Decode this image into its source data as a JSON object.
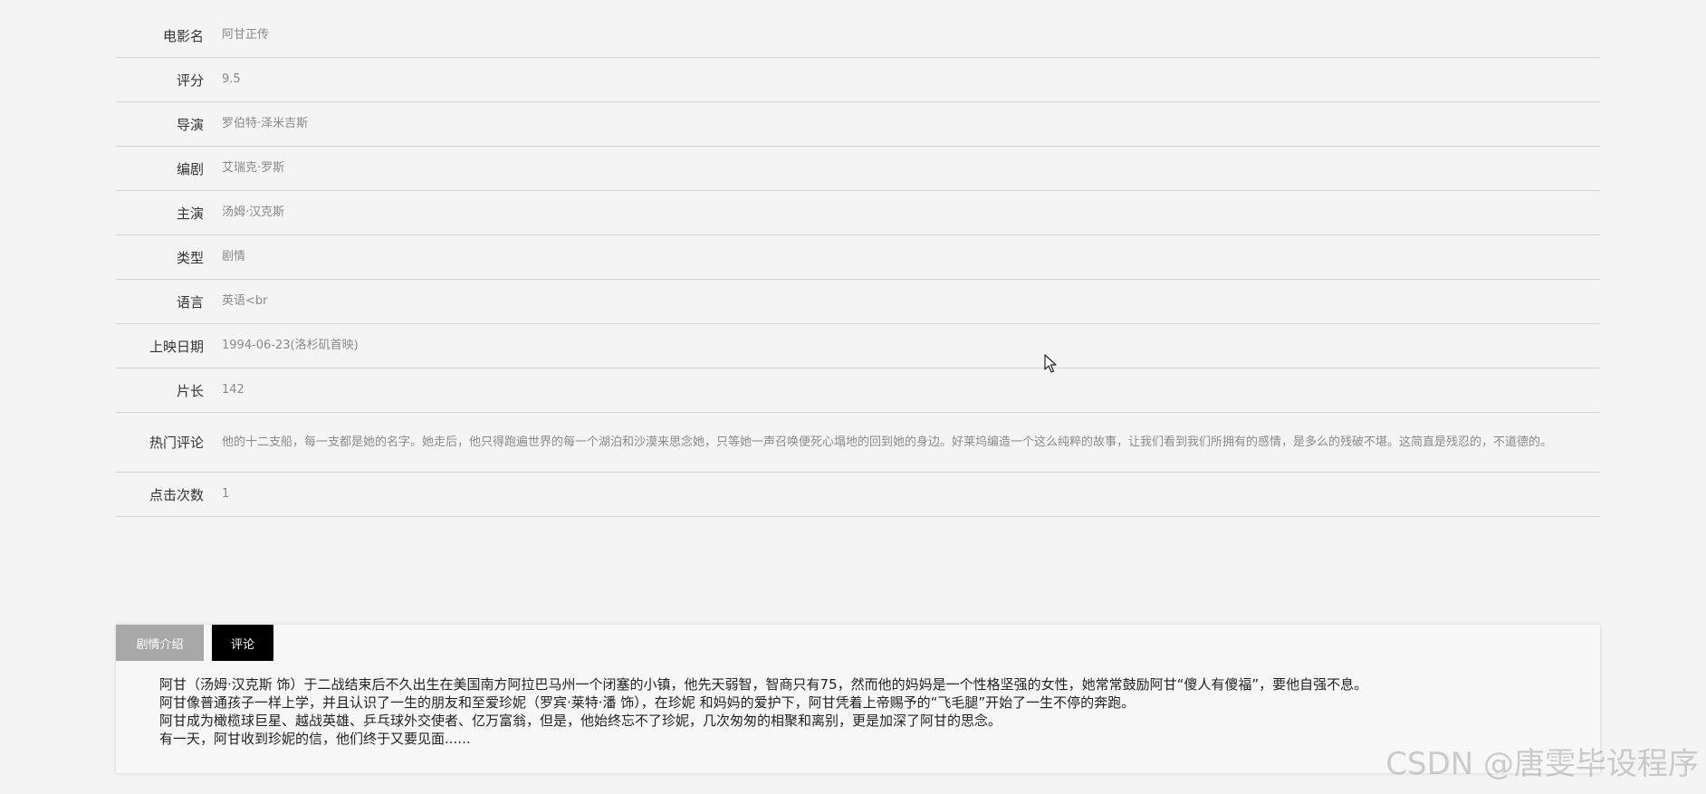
{
  "movie": {
    "rows": [
      {
        "label": "电影名",
        "value": "阿甘正传"
      },
      {
        "label": "评分",
        "value": "9.5"
      },
      {
        "label": "导演",
        "value": "罗伯特·泽米吉斯"
      },
      {
        "label": "编剧",
        "value": "艾瑞克·罗斯"
      },
      {
        "label": "主演",
        "value": "汤姆·汉克斯"
      },
      {
        "label": "类型",
        "value": "剧情"
      },
      {
        "label": "语言",
        "value": "英语<br"
      },
      {
        "label": "上映日期",
        "value": "1994-06-23(洛杉矶首映)"
      },
      {
        "label": "片长",
        "value": "142"
      },
      {
        "label": "热门评论",
        "value": "他的十二支船，每一支都是她的名字。她走后，他只得跑遍世界的每一个湖泊和沙漠来思念她，只等她一声召唤便死心塌地的回到她的身边。好莱坞编造一个这么纯粹的故事，让我们看到我们所拥有的感情，是多么的残破不堪。这简直是残忍的，不道德的。"
      },
      {
        "label": "点击次数",
        "value": "1"
      }
    ]
  },
  "tabs": {
    "plot_label": "剧情介绍",
    "comment_label": "评论"
  },
  "plot": {
    "paragraphs": [
      "阿甘（汤姆·汉克斯 饰）于二战结束后不久出生在美国南方阿拉巴马州一个闭塞的小镇，他先天弱智，智商只有75，然而他的妈妈是一个性格坚强的女性，她常常鼓励阿甘“傻人有傻福”，要他自强不息。",
      "阿甘像普通孩子一样上学，并且认识了一生的朋友和至爱珍妮（罗宾·莱特·潘 饰），在珍妮 和妈妈的爱护下，阿甘凭着上帝赐予的“飞毛腿”开始了一生不停的奔跑。",
      "阿甘成为橄榄球巨星、越战英雄、乒乓球外交使者、亿万富翁，但是，他始终忘不了珍妮，几次匆匆的相聚和离别，更是加深了阿甘的思念。",
      "有一天，阿甘收到珍妮的信，他们终于又要见面......"
    ]
  },
  "watermark": "CSDN @唐雯毕设程序",
  "icons": {
    "cursor": "mouse-pointer-icon"
  }
}
